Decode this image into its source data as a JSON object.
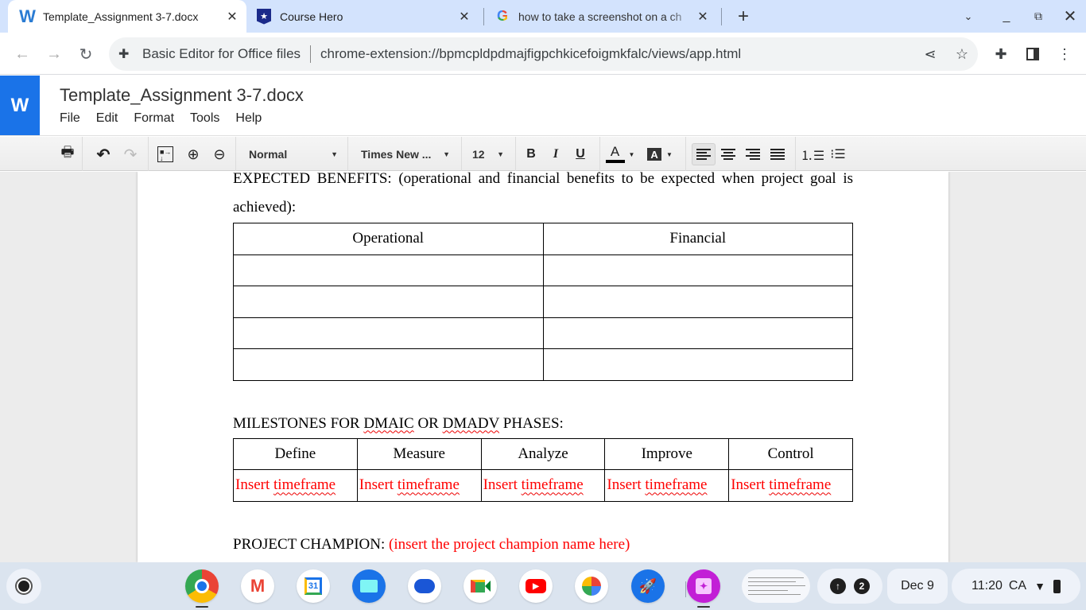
{
  "browser": {
    "tabs": [
      {
        "title": "Template_Assignment 3-7.docx",
        "icon": "word-icon",
        "active": true
      },
      {
        "title": "Course Hero",
        "icon": "course-hero-icon",
        "active": false
      },
      {
        "title": "how to take a screenshot on a ch",
        "icon": "google-icon",
        "active": false
      }
    ],
    "new_tab_label": "+",
    "address": {
      "site_label": "Basic Editor for Office files",
      "url": "chrome-extension://bpmcpldpdmajfigpchkicefoigmkfalc/views/app.html"
    }
  },
  "app": {
    "logo_letter": "W",
    "doc_title": "Template_Assignment 3-7.docx",
    "menu": [
      "File",
      "Edit",
      "Format",
      "Tools",
      "Help"
    ],
    "toolbar": {
      "paragraph_style": "Normal",
      "font_family": "Times New ...",
      "font_size": "12",
      "bold": "B",
      "italic": "I",
      "underline": "U",
      "text_color": "#000000",
      "active_alignment": "left"
    }
  },
  "document": {
    "benefits_heading": "EXPECTED BENEFITS: (operational and financial benefits to be expected when project goal is achieved):",
    "benefits_table": {
      "headers": [
        "Operational",
        "Financial"
      ],
      "rows": [
        [
          "",
          ""
        ],
        [
          "",
          ""
        ],
        [
          "",
          ""
        ],
        [
          "",
          ""
        ]
      ]
    },
    "milestones_heading_parts": [
      "MILESTONES FOR ",
      "DMAIC",
      " OR ",
      "DMADV",
      " PHASES:"
    ],
    "milestones_table": {
      "headers": [
        "Define",
        "Measure",
        "Analyze",
        "Improve",
        "Control"
      ],
      "values": [
        {
          "word1": "Insert ",
          "word2": "timeframe"
        },
        {
          "word1": "Insert ",
          "word2": "timeframe"
        },
        {
          "word1": "Insert ",
          "word2": "timeframe"
        },
        {
          "word1": "Insert ",
          "word2": "timeframe"
        },
        {
          "word1": "Insert ",
          "word2": "timeframe"
        }
      ]
    },
    "champion_label": "PROJECT CHAMPION: ",
    "champion_placeholder": "(insert the project champion name here)",
    "placeholder_color": "#ff0000"
  },
  "shelf": {
    "apps": [
      "Chrome",
      "Gmail",
      "Calendar",
      "Files",
      "Messages",
      "Meet",
      "YouTube",
      "Photos",
      "Rocket app",
      "Gallery"
    ],
    "calendar_day": "31",
    "notification_count": "2",
    "date": "Dec 9",
    "time": "11:20",
    "locale": "CA"
  }
}
